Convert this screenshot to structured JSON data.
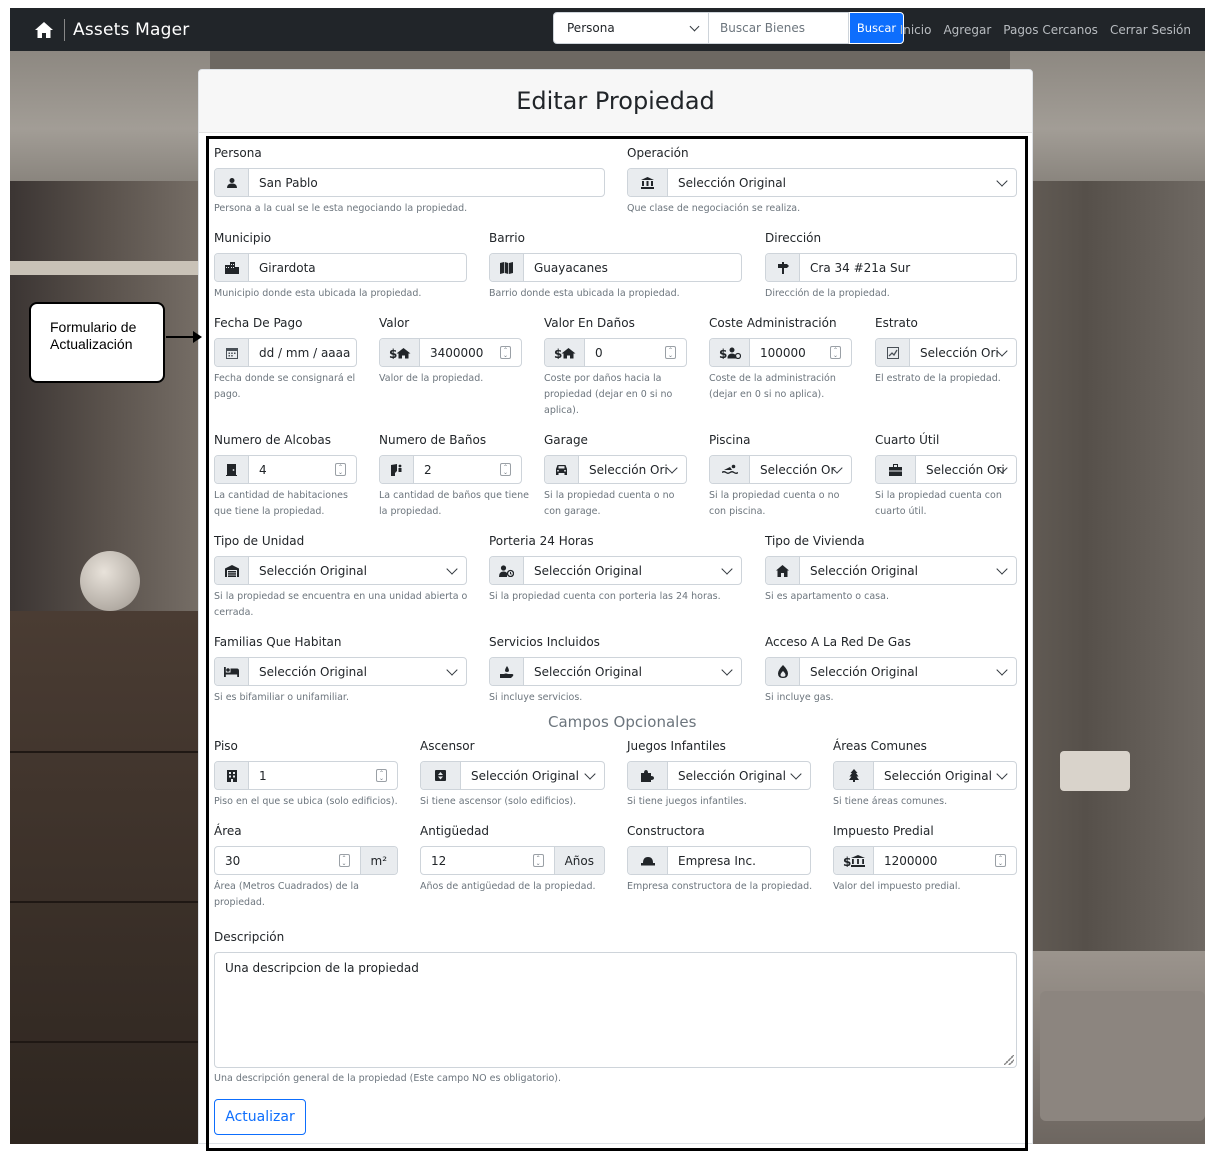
{
  "navbar": {
    "brand": "Assets Mager",
    "search_select": "Persona",
    "search_placeholder": "Buscar Bienes",
    "search_button": "Buscar",
    "links": [
      "Inicio",
      "Agregar",
      "Pagos Cercanos",
      "Cerrar Sesión"
    ]
  },
  "card": {
    "title": "Editar Propiedad"
  },
  "callout": {
    "line1": "Formulario de",
    "line2": "Actualización"
  },
  "fields": {
    "persona": {
      "label": "Persona",
      "value": "San Pablo",
      "help": "Persona a la cual se le esta negociando la propiedad."
    },
    "operacion": {
      "label": "Operación",
      "value": "Selección Original",
      "help": "Que clase de negociación se realiza."
    },
    "municipio": {
      "label": "Municipio",
      "value": "Girardota",
      "help": "Municipio donde esta ubicada la propiedad."
    },
    "barrio": {
      "label": "Barrio",
      "value": "Guayacanes",
      "help": "Barrio donde esta ubicada la propiedad."
    },
    "direccion": {
      "label": "Dirección",
      "value": "Cra 34 #21a Sur",
      "help": "Dirección de la propiedad."
    },
    "fecha_pago": {
      "label": "Fecha De Pago",
      "value": "dd / mm / aaaa",
      "help": "Fecha donde se consignará el pago."
    },
    "valor": {
      "label": "Valor",
      "value": "3400000",
      "help": "Valor de la propiedad."
    },
    "valor_danos": {
      "label": "Valor En Daños",
      "value": "0",
      "help": "Coste por daños hacia la propiedad (dejar en 0 si no aplica)."
    },
    "coste_admin": {
      "label": "Coste Administración",
      "value": "100000",
      "help": "Coste de la administración (dejar en 0 si no aplica)."
    },
    "estrato": {
      "label": "Estrato",
      "value": "Selección Ori",
      "help": "El estrato de la propiedad."
    },
    "alcobas": {
      "label": "Numero de Alcobas",
      "value": "4",
      "help": "La cantidad de habitaciones que tiene la propiedad."
    },
    "banos": {
      "label": "Numero de Baños",
      "value": "2",
      "help": "La cantidad de baños que tiene la propiedad."
    },
    "garage": {
      "label": "Garage",
      "value": "Selección Ori",
      "help": "Si la propiedad cuenta o no con garage."
    },
    "piscina": {
      "label": "Piscina",
      "value": "Selección Or",
      "help": "Si la propiedad cuenta o no con piscina."
    },
    "cuarto_util": {
      "label": "Cuarto Útil",
      "value": "Selección Ori",
      "help": "Si la propiedad cuenta con cuarto útil."
    },
    "tipo_unidad": {
      "label": "Tipo de Unidad",
      "value": "Selección Original",
      "help": "Si la propiedad se encuentra en una unidad abierta o cerrada."
    },
    "porteria": {
      "label": "Porteria 24 Horas",
      "value": "Selección Original",
      "help": "Si la propiedad cuenta con porteria las 24 horas."
    },
    "tipo_vivienda": {
      "label": "Tipo de Vivienda",
      "value": "Selección Original",
      "help": "Si es apartamento o casa."
    },
    "familias": {
      "label": "Familias Que Habitan",
      "value": "Selección Original",
      "help": "Si es bifamiliar o unifamiliar."
    },
    "servicios": {
      "label": "Servicios Incluidos",
      "value": "Selección Original",
      "help": "Si incluye servicios."
    },
    "gas": {
      "label": "Acceso A La Red De Gas",
      "value": "Selección Original",
      "help": "Si incluye gas."
    },
    "opcionales_title": "Campos Opcionales",
    "piso": {
      "label": "Piso",
      "value": "1",
      "help": "Piso en el que se ubica (solo edificios)."
    },
    "ascensor": {
      "label": "Ascensor",
      "value": "Selección Original",
      "help": "Si tiene ascensor (solo edificios)."
    },
    "juegos": {
      "label": "Juegos Infantiles",
      "value": "Selección Original",
      "help": "Si tiene juegos infantiles."
    },
    "areas_comunes": {
      "label": "Áreas Comunes",
      "value": "Selección Original",
      "help": "Si tiene áreas comunes."
    },
    "area": {
      "label": "Área",
      "value": "30",
      "unit": "m²",
      "help": "Área (Metros Cuadrados) de la propiedad."
    },
    "antiguedad": {
      "label": "Antigüedad",
      "value": "12",
      "unit": "Años",
      "help": "Años de antigüedad de la propiedad."
    },
    "constructora": {
      "label": "Constructora",
      "value": "Empresa Inc.",
      "help": "Empresa constructora de la propiedad."
    },
    "impuesto": {
      "label": "Impuesto Predial",
      "value": "1200000",
      "help": "Valor del impuesto predial."
    },
    "descripcion": {
      "label": "Descripción",
      "value": "Una descripcion de la propiedad",
      "help": "Una descripción general de la propiedad (Este campo NO es obligatorio)."
    }
  },
  "submit_label": "Actualizar",
  "colors": {
    "navbar": "#212529",
    "primary": "#0d6efd",
    "help_text": "#6c757d",
    "addon_bg": "#e9ecef"
  }
}
